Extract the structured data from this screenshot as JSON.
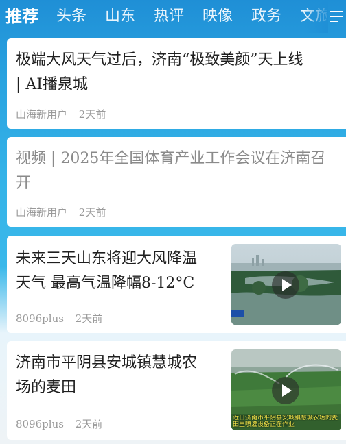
{
  "tabs": [
    {
      "label": "推荐",
      "active": true
    },
    {
      "label": "头条"
    },
    {
      "label": "山东"
    },
    {
      "label": "热评"
    },
    {
      "label": "映像"
    },
    {
      "label": "政务"
    },
    {
      "label": "文旅"
    }
  ],
  "articles": [
    {
      "title_line1": "极端大风天气过后，济南“极致美颜”天上线",
      "title_line2": "| AI播泉城",
      "source": "山海新用户",
      "time": "2天前",
      "read": false
    },
    {
      "title_line1": "视频 | 2025年全国体育产业工作会议在济南召",
      "title_line2": "开",
      "source": "山海新用户",
      "time": "2天前",
      "read": true
    },
    {
      "title_line1": "未来三天山东将迎大风降温",
      "title_line2": "天气 最高气温降幅8-12°C",
      "source": "8096plus",
      "time": "2天前",
      "has_video": true,
      "thumb_icon": "video-thumbnail-lake-aerial"
    },
    {
      "title_line1": "济南市平阴县安城镇慧城农",
      "title_line2": "场的麦田",
      "source": "8096plus",
      "time": "2天前",
      "has_video": true,
      "thumb_icon": "video-thumbnail-wheat-field",
      "thumb_caption": "近日济南市平阴县安城镇慧城农场的麦田里喷灌设备正在作业"
    }
  ],
  "colors": {
    "header_blue": "#1f8fd6",
    "title_text": "#1f1f1f",
    "read_title_text": "#8a8a8a",
    "meta_text": "#9a9a9a"
  }
}
